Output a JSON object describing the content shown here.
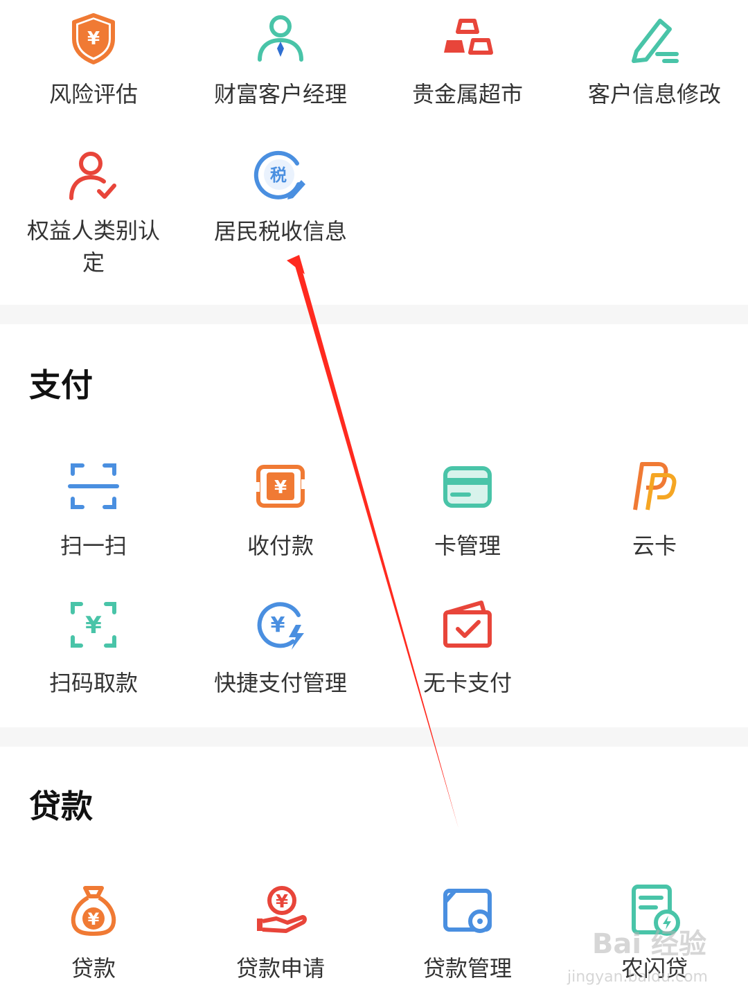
{
  "top_services": {
    "items": [
      {
        "label": "风险评估",
        "icon": "shield-yuan-icon"
      },
      {
        "label": "财富客户经理",
        "icon": "manager-icon"
      },
      {
        "label": "贵金属超市",
        "icon": "gold-bars-icon"
      },
      {
        "label": "客户信息修改",
        "icon": "edit-pen-icon"
      },
      {
        "label": "权益人类别认定",
        "icon": "user-check-icon"
      },
      {
        "label": "居民税收信息",
        "icon": "tax-edit-icon"
      }
    ]
  },
  "payment": {
    "title": "支付",
    "items": [
      {
        "label": "扫一扫",
        "icon": "scan-icon"
      },
      {
        "label": "收付款",
        "icon": "receive-pay-icon"
      },
      {
        "label": "卡管理",
        "icon": "card-icon"
      },
      {
        "label": "云卡",
        "icon": "cloud-card-icon"
      },
      {
        "label": "扫码取款",
        "icon": "scan-withdraw-icon"
      },
      {
        "label": "快捷支付管理",
        "icon": "quick-pay-icon"
      },
      {
        "label": "无卡支付",
        "icon": "cardless-pay-icon"
      }
    ]
  },
  "loan": {
    "title": "贷款",
    "items": [
      {
        "label": "贷款",
        "icon": "money-bag-icon"
      },
      {
        "label": "贷款申请",
        "icon": "loan-apply-icon"
      },
      {
        "label": "贷款管理",
        "icon": "loan-manage-icon"
      },
      {
        "label": "农闪贷",
        "icon": "quick-loan-icon"
      }
    ]
  },
  "colors": {
    "orange": "#f07a34",
    "teal": "#49c4a8",
    "red": "#e8453a",
    "blue": "#4a8fe0",
    "arrow": "#ff2a1f"
  }
}
